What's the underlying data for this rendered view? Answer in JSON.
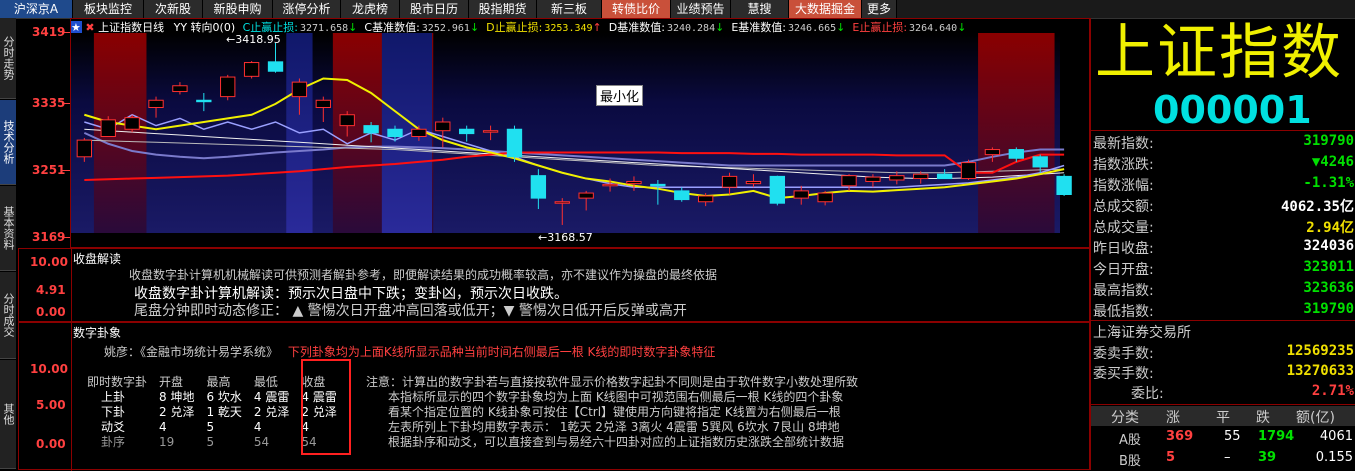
{
  "nav": {
    "tabs": [
      "沪深京A",
      "板块监控",
      "次新股",
      "新股申购",
      "涨停分析",
      "龙虎榜",
      "股市日历",
      "股指期货",
      "新三板",
      "转债比价",
      "业绩预告",
      "慧搜",
      "大数据掘金",
      "更多"
    ]
  },
  "left_tabs": [
    "分时走势",
    "技术分析",
    "基本资料",
    "分时成交",
    "其他"
  ],
  "chart_header": {
    "title": "上证指数",
    "period": "日线",
    "ind1": "YY 转向0(0)",
    "items": [
      {
        "label": "C止赢止损:",
        "value": "3271.658",
        "arrow": "↓"
      },
      {
        "label": "C基准数值:",
        "value": "3252.961",
        "arrow": "↓"
      },
      {
        "label": "D止赢止损:",
        "value": "3253.349",
        "arrow": "↑"
      },
      {
        "label": "D基准数值:",
        "value": "3240.284",
        "arrow": "↓"
      },
      {
        "label": "E基准数值:",
        "value": "3246.665",
        "arrow": "↓"
      },
      {
        "label": "E止赢止损:",
        "value": "3264.640",
        "arrow": "↓"
      }
    ],
    "minimize": "最小化",
    "high_mark": "3418.95",
    "low_mark": "3168.57"
  },
  "y_axis": [
    "3419",
    "3335",
    "3251",
    "3169"
  ],
  "chart_data": {
    "type": "candlestick",
    "ylim": [
      3150,
      3430
    ],
    "candles": [
      {
        "o": 3262,
        "h": 3288,
        "l": 3255,
        "c": 3285
      },
      {
        "o": 3290,
        "h": 3318,
        "l": 3290,
        "c": 3313
      },
      {
        "o": 3300,
        "h": 3320,
        "l": 3296,
        "c": 3316
      },
      {
        "o": 3330,
        "h": 3345,
        "l": 3316,
        "c": 3340
      },
      {
        "o": 3352,
        "h": 3365,
        "l": 3348,
        "c": 3360
      },
      {
        "o": 3340,
        "h": 3350,
        "l": 3325,
        "c": 3338
      },
      {
        "o": 3345,
        "h": 3375,
        "l": 3340,
        "c": 3372
      },
      {
        "o": 3373,
        "h": 3394,
        "l": 3370,
        "c": 3392
      },
      {
        "o": 3393,
        "h": 3419,
        "l": 3378,
        "c": 3380
      },
      {
        "o": 3345,
        "h": 3370,
        "l": 3320,
        "c": 3365
      },
      {
        "o": 3330,
        "h": 3345,
        "l": 3310,
        "c": 3340
      },
      {
        "o": 3305,
        "h": 3325,
        "l": 3290,
        "c": 3320
      },
      {
        "o": 3305,
        "h": 3310,
        "l": 3282,
        "c": 3295
      },
      {
        "o": 3300,
        "h": 3305,
        "l": 3283,
        "c": 3290
      },
      {
        "o": 3290,
        "h": 3305,
        "l": 3284,
        "c": 3300
      },
      {
        "o": 3298,
        "h": 3316,
        "l": 3275,
        "c": 3310
      },
      {
        "o": 3300,
        "h": 3305,
        "l": 3283,
        "c": 3294
      },
      {
        "o": 3296,
        "h": 3305,
        "l": 3285,
        "c": 3298
      },
      {
        "o": 3300,
        "h": 3305,
        "l": 3255,
        "c": 3262
      },
      {
        "o": 3236,
        "h": 3245,
        "l": 3190,
        "c": 3205
      },
      {
        "o": 3198,
        "h": 3205,
        "l": 3168,
        "c": 3200
      },
      {
        "o": 3205,
        "h": 3215,
        "l": 3188,
        "c": 3212
      },
      {
        "o": 3222,
        "h": 3232,
        "l": 3214,
        "c": 3224
      },
      {
        "o": 3225,
        "h": 3235,
        "l": 3215,
        "c": 3228
      },
      {
        "o": 3224,
        "h": 3230,
        "l": 3196,
        "c": 3222
      },
      {
        "o": 3215,
        "h": 3220,
        "l": 3200,
        "c": 3203
      },
      {
        "o": 3200,
        "h": 3212,
        "l": 3194,
        "c": 3208
      },
      {
        "o": 3220,
        "h": 3240,
        "l": 3210,
        "c": 3235
      },
      {
        "o": 3225,
        "h": 3238,
        "l": 3220,
        "c": 3228
      },
      {
        "o": 3235,
        "h": 3236,
        "l": 3195,
        "c": 3198
      },
      {
        "o": 3205,
        "h": 3222,
        "l": 3196,
        "c": 3215
      },
      {
        "o": 3200,
        "h": 3215,
        "l": 3195,
        "c": 3212
      },
      {
        "o": 3222,
        "h": 3238,
        "l": 3215,
        "c": 3236
      },
      {
        "o": 3228,
        "h": 3238,
        "l": 3220,
        "c": 3234
      },
      {
        "o": 3230,
        "h": 3242,
        "l": 3224,
        "c": 3236
      },
      {
        "o": 3232,
        "h": 3242,
        "l": 3225,
        "c": 3238
      },
      {
        "o": 3238,
        "h": 3245,
        "l": 3232,
        "c": 3232
      },
      {
        "o": 3232,
        "h": 3258,
        "l": 3230,
        "c": 3254
      },
      {
        "o": 3265,
        "h": 3275,
        "l": 3255,
        "c": 3272
      },
      {
        "o": 3272,
        "h": 3275,
        "l": 3255,
        "c": 3260
      },
      {
        "o": 3262,
        "h": 3265,
        "l": 3240,
        "c": 3248
      },
      {
        "o": 3235,
        "h": 3238,
        "l": 3208,
        "c": 3210
      }
    ],
    "zones": [
      [
        1,
        2
      ],
      [
        11,
        14
      ],
      [
        38,
        40
      ]
    ],
    "blue_zones": [
      [
        9,
        9
      ],
      [
        13,
        14
      ]
    ],
    "lines": {
      "yellow": [
        3320,
        3310,
        3305,
        3300,
        3305,
        3310,
        3315,
        3320,
        3335,
        3355,
        3370,
        3368,
        3350,
        3325,
        3300,
        3285,
        3275,
        3268,
        3260,
        3250,
        3240,
        3232,
        3228,
        3222,
        3218,
        3212,
        3208,
        3210,
        3215,
        3205,
        3208,
        3212,
        3215,
        3214,
        3216,
        3218,
        3220,
        3224,
        3228,
        3232,
        3238,
        3245
      ],
      "red": [
        3230,
        3231,
        3232,
        3233,
        3234,
        3235,
        3236,
        3238,
        3240,
        3242,
        3245,
        3248,
        3250,
        3252,
        3255,
        3258,
        3262,
        3265,
        3268,
        3268,
        3268,
        3268,
        3268,
        3268,
        3268,
        3267,
        3267,
        3267,
        3266,
        3266,
        3265,
        3265,
        3265,
        3265,
        3264,
        3264,
        3264,
        3240,
        3240,
        3255,
        3265,
        3265
      ],
      "white1": [
        3300,
        3298,
        3296,
        3294,
        3292,
        3290,
        3288,
        3286,
        3284,
        3282,
        3280,
        3278,
        3276,
        3274,
        3272,
        3270,
        3268,
        3266,
        3264,
        3262,
        3260,
        3258,
        3256,
        3254,
        3252,
        3250,
        3248,
        3246,
        3244,
        3242,
        3240,
        3238,
        3236,
        3234,
        3233,
        3232,
        3232,
        3233,
        3234,
        3236,
        3238,
        3240
      ],
      "white2": [
        3285,
        3284,
        3283,
        3282,
        3281,
        3280,
        3279,
        3278,
        3277,
        3276,
        3275,
        3274,
        3273,
        3272,
        3270,
        3268,
        3266,
        3264,
        3262,
        3260,
        3258,
        3256,
        3254,
        3252,
        3250,
        3249,
        3248,
        3247,
        3246,
        3245,
        3244,
        3243,
        3242,
        3241,
        3240,
        3240,
        3240,
        3241,
        3242,
        3243,
        3244,
        3245
      ],
      "steel": [
        3295,
        3280,
        3270,
        3265,
        3262,
        3260,
        3262,
        3265,
        3268,
        3270,
        3272,
        3275,
        3276,
        3276,
        3275,
        3274,
        3272,
        3270,
        3268,
        3266,
        3264,
        3262,
        3260,
        3258,
        3256,
        3254,
        3252,
        3250,
        3250,
        3250,
        3250,
        3250,
        3250,
        3250,
        3250,
        3250,
        3250,
        3255,
        3262,
        3268,
        3272,
        3272
      ],
      "zigzag": [
        3310,
        3300,
        3320,
        3305,
        3315,
        3300,
        3310,
        3300,
        3310,
        3295,
        3300,
        3280,
        3295,
        3285,
        3300,
        3290,
        3280,
        3270,
        3262,
        3250,
        3240,
        3232,
        3225,
        3220,
        3220,
        3220,
        3220,
        3220,
        3220,
        3220,
        3220,
        3220,
        3220,
        3220,
        3220,
        3222,
        3224,
        3226,
        3230,
        3234,
        3240,
        3250
      ]
    }
  },
  "panel1": {
    "title": "收盘解读",
    "y": [
      "10.00",
      "4.91",
      "0.00"
    ],
    "line1": "收盘数字卦计算机机械解读可供预测者解卦参考，即便解读结果的成功概率较高，亦不建议作为操盘的最终依据",
    "line2": "收盘数字卦计算机解读：预示次日盘中下跌；变卦凶，预示次日收跌。",
    "line3": "尾盘分钟即时动态修正：  ▲  警惕次日开盘冲高回落或低开；▼  警惕次日低开后反弹或高开"
  },
  "panel2": {
    "title": "数字卦象",
    "y": [
      "10.00",
      "5.00",
      "0.00"
    ],
    "author": "姚彦：《金融市场统计易学系统》",
    "author_note": "下列卦象均为上面K线所显示品种当前时间右侧最后一根 K线的即时数字卦象特征",
    "table_header": [
      "即时数字卦",
      "开盘",
      "最高",
      "最低",
      "收盘"
    ],
    "rows": [
      [
        "上卦",
        "8 坤地",
        "6 坎水",
        "4 震雷",
        "4 震雷"
      ],
      [
        "下卦",
        "2 兑泽",
        "1 乾天",
        "2 兑泽",
        "2 兑泽"
      ],
      [
        "动爻",
        "4",
        "5",
        "4",
        "4"
      ],
      [
        "卦序",
        "19",
        "5",
        "54",
        "54"
      ]
    ],
    "notes": [
      "注意：计算出的数字卦若与直接按软件显示价格数字起卦不同则是由于软件数字小数处理所致",
      "本指标所显示的四个数字卦象均为上面 K线图中可视范围右侧最后一根 K线的四个卦象",
      "看某个指定位置的 K线卦象可按住【Ctrl】键使用方向键将指定 K线置为右侧最后一根",
      "左表所列上下卦均用数字表示： 1乾天 2兑泽 3离火 4震雷 5巽风 6坎水 7艮山 8坤地",
      "根据卦序和动爻，可以直接查到与易经六十四卦对应的上证指数历史涨跌全部统计数据"
    ]
  },
  "right": {
    "name": "上证指数",
    "code": "000001",
    "stats": [
      {
        "label": "最新指数:",
        "value": "319790",
        "color": "grn"
      },
      {
        "label": "指数涨跌:",
        "value": "▼4246",
        "color": "grn"
      },
      {
        "label": "指数涨幅:",
        "value": "-1.31%",
        "color": "grn"
      },
      {
        "label": "总成交额:",
        "value": "4062.35亿",
        "color": "wht"
      },
      {
        "label": "总成交量:",
        "value": "2.94亿",
        "color": "yel"
      },
      {
        "label": "昨日收盘:",
        "value": "324036",
        "color": "wht"
      },
      {
        "label": "今日开盘:",
        "value": "323011",
        "color": "grn"
      },
      {
        "label": "最高指数:",
        "value": "323636",
        "color": "grn"
      },
      {
        "label": "最低指数:",
        "value": "319790",
        "color": "grn"
      }
    ],
    "exchange": "上海证券交易所",
    "order_stats": [
      {
        "label": "委卖手数:",
        "value": "12569235",
        "color": "yel"
      },
      {
        "label": "委买手数:",
        "value": "13270633",
        "color": "yel"
      },
      {
        "label": "委比:",
        "value": "2.71%",
        "color": "red"
      }
    ],
    "breadth_header": [
      "分类",
      "涨",
      "平",
      "跌",
      "额(亿)"
    ],
    "breadth": [
      {
        "name": "A股",
        "up": "369",
        "flat": "55",
        "down": "1794",
        "amt": "4061"
      },
      {
        "name": "B股",
        "up": "5",
        "flat": "–",
        "down": "39",
        "amt": "0.155"
      }
    ]
  }
}
